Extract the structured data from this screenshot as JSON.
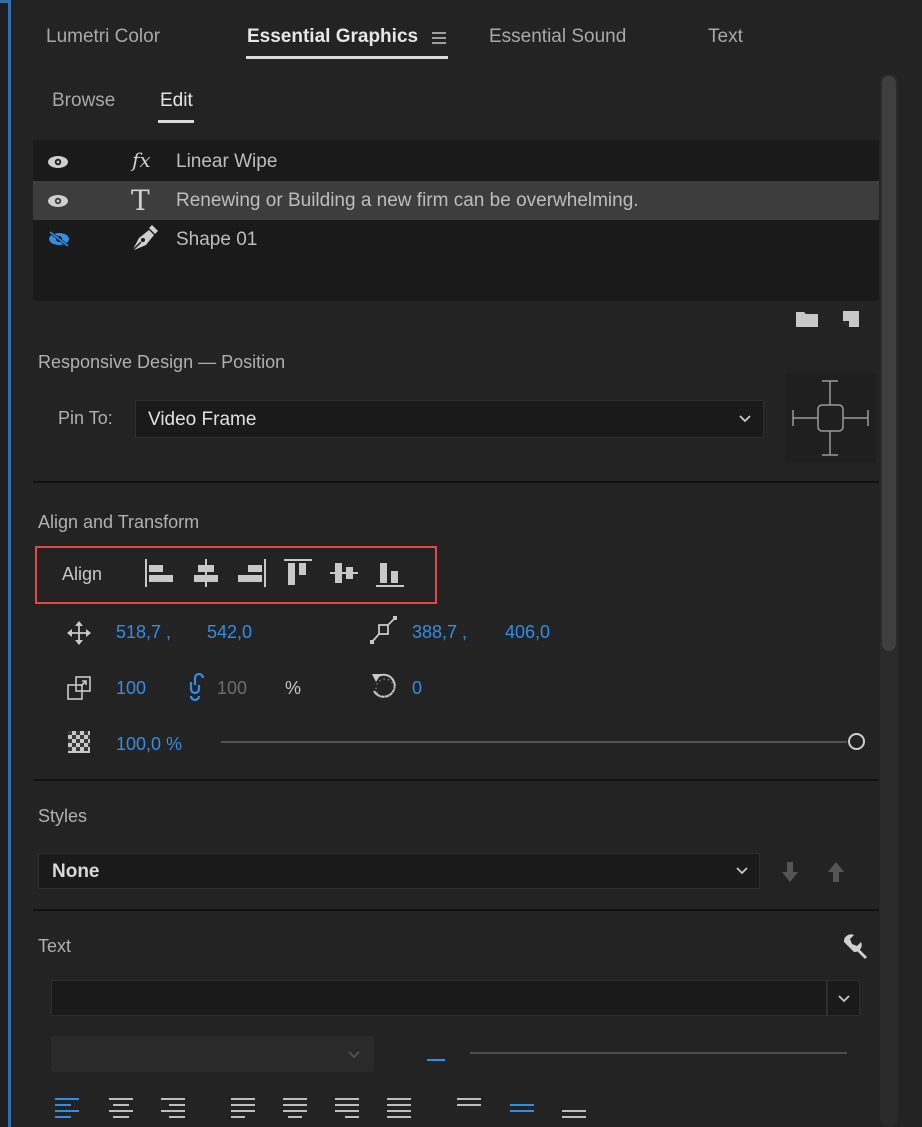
{
  "tabs": [
    "Lumetri Color",
    "Essential Graphics",
    "Essential Sound",
    "Text"
  ],
  "subtabs": [
    "Browse",
    "Edit"
  ],
  "layers": [
    {
      "icon": "fx-icon",
      "name": "Linear Wipe"
    },
    {
      "icon": "type-tool-icon",
      "name": "Renewing or Building a new firm can be overwhelming."
    },
    {
      "icon": "pen-tool-icon",
      "name": "Shape 01"
    }
  ],
  "responsive": {
    "title": "Responsive Design — Position",
    "pin_label": "Pin To:",
    "pin_value": "Video Frame"
  },
  "align_transform": {
    "title": "Align and Transform",
    "align_label": "Align",
    "position_x": "518,7 ,",
    "position_y": "542,0",
    "anchor_x": "388,7 ,",
    "anchor_y": "406,0",
    "scale": "100",
    "scale_width": "100",
    "scale_unit": "%",
    "rotation": "0",
    "opacity": "100,0 %"
  },
  "styles": {
    "title": "Styles",
    "value": "None"
  },
  "text_section": {
    "title": "Text"
  },
  "colors": {
    "accent": "#2f8ee6",
    "highlight_box": "#e04848"
  }
}
